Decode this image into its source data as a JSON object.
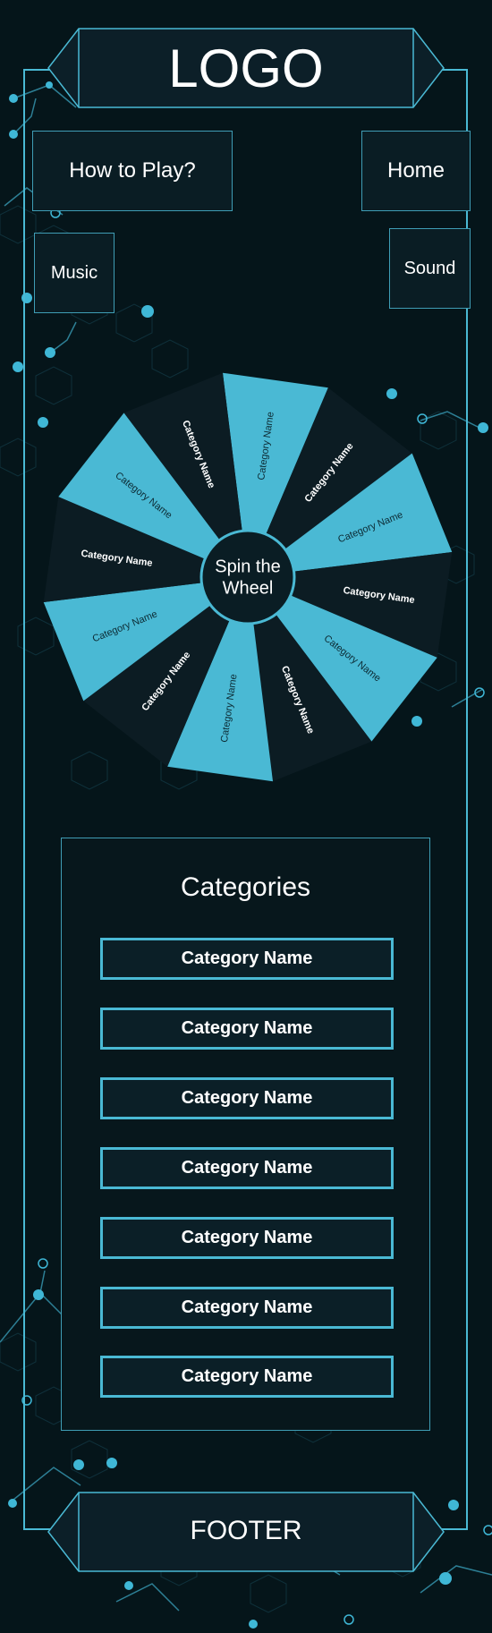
{
  "header": {
    "logo": "LOGO"
  },
  "nav": {
    "how_to_play": "How to Play?",
    "home": "Home",
    "music": "Music",
    "sound": "Sound"
  },
  "wheel": {
    "center_label_line1": "Spin the",
    "center_label_line2": "Wheel",
    "segments": [
      "Category Name",
      "Category Name",
      "Category Name",
      "Category Name",
      "Category Name",
      "Category Name",
      "Category Name",
      "Category Name",
      "Category Name",
      "Category Name",
      "Category Name",
      "Category Name"
    ]
  },
  "categories": {
    "title": "Categories",
    "items": [
      "Category Name",
      "Category Name",
      "Category Name",
      "Category Name",
      "Category Name",
      "Category Name",
      "Category Name"
    ]
  },
  "footer": {
    "label": "FOOTER"
  },
  "colors": {
    "background": "#05151a",
    "accent": "#4ab9d4",
    "panel": "#0a1d24",
    "dark_segment": "#0c1c23"
  }
}
